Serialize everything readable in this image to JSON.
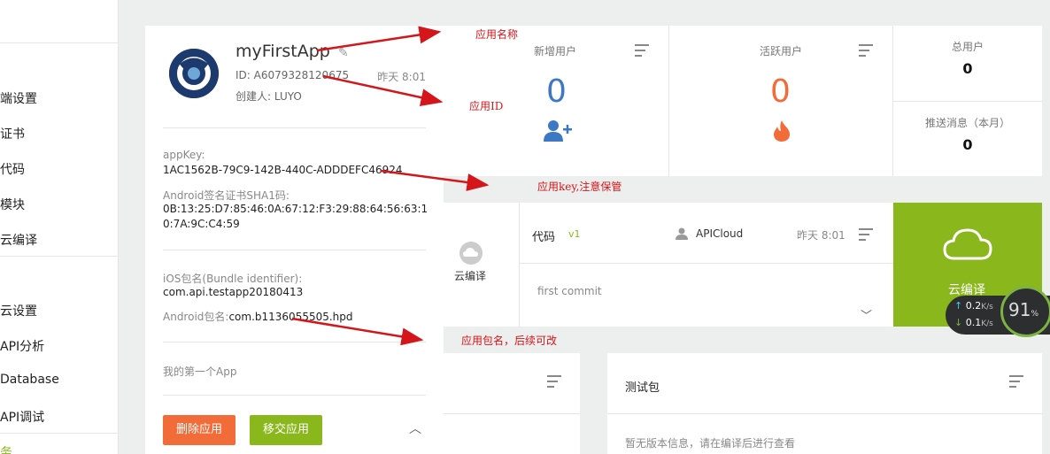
{
  "sidebar": {
    "items": [
      {
        "label": "端设置"
      },
      {
        "label": "证书"
      },
      {
        "label": "代码"
      },
      {
        "label": "模块"
      },
      {
        "label": "云编译"
      },
      {
        "label": "云设置"
      },
      {
        "label": "API分析"
      },
      {
        "label": "Database"
      },
      {
        "label": "API调试"
      },
      {
        "label": "务"
      }
    ]
  },
  "app": {
    "name": "myFirstApp",
    "id": "ID: A6079328120675",
    "time": "昨天 8:01",
    "creator": "创建人: LUYO",
    "appkey_label": "appKey:",
    "appkey_value": "1AC1562B-79C9-142B-440C-ADDDEFC46924",
    "sha1_label": "Android签名证书SHA1码:",
    "sha1_value": "0B:13:25:D7:85:46:0A:67:12:F3:29:88:64:56:63:10:7A:9C:C4:59",
    "ios_label": "iOS包名(Bundle identifier):",
    "ios_value": "com.api.testapp20180413",
    "android_label": "Android包名:",
    "android_value": "com.b1136055505.hpd",
    "description": "我的第一个App",
    "delete_label": "删除应用",
    "transfer_label": "移交应用"
  },
  "stats": {
    "new_users_title": "新增用户",
    "new_users_value": "0",
    "active_users_title": "活跃用户",
    "active_users_value": "0",
    "total_users_title": "总用户",
    "total_users_value": "0",
    "push_title": "推送消息（本月）",
    "push_value": "0"
  },
  "build": {
    "cloud_compile_label": "云编译",
    "code_label": "代码",
    "code_version": "v1",
    "author": "APICloud",
    "time": "昨天 8:01",
    "commit_message": "first commit",
    "green_button_label": "云编译"
  },
  "test_panel": {
    "title": "测试包",
    "empty_text": "暂无版本信息，请在编译后进行查看"
  },
  "annotations": {
    "app_name": "应用名称",
    "app_id": "应用ID",
    "app_key": "应用key,注意保管",
    "package": "应用包名，后续可改"
  },
  "speed": {
    "up": "0.2",
    "down": "0.1",
    "unit": "K/s",
    "percent": "91",
    "percent_sign": "%"
  },
  "colors": {
    "accent_green": "#8ab71c",
    "blue": "#3c78c3",
    "orange": "#f26c39",
    "annotation_red": "#d4161a"
  }
}
